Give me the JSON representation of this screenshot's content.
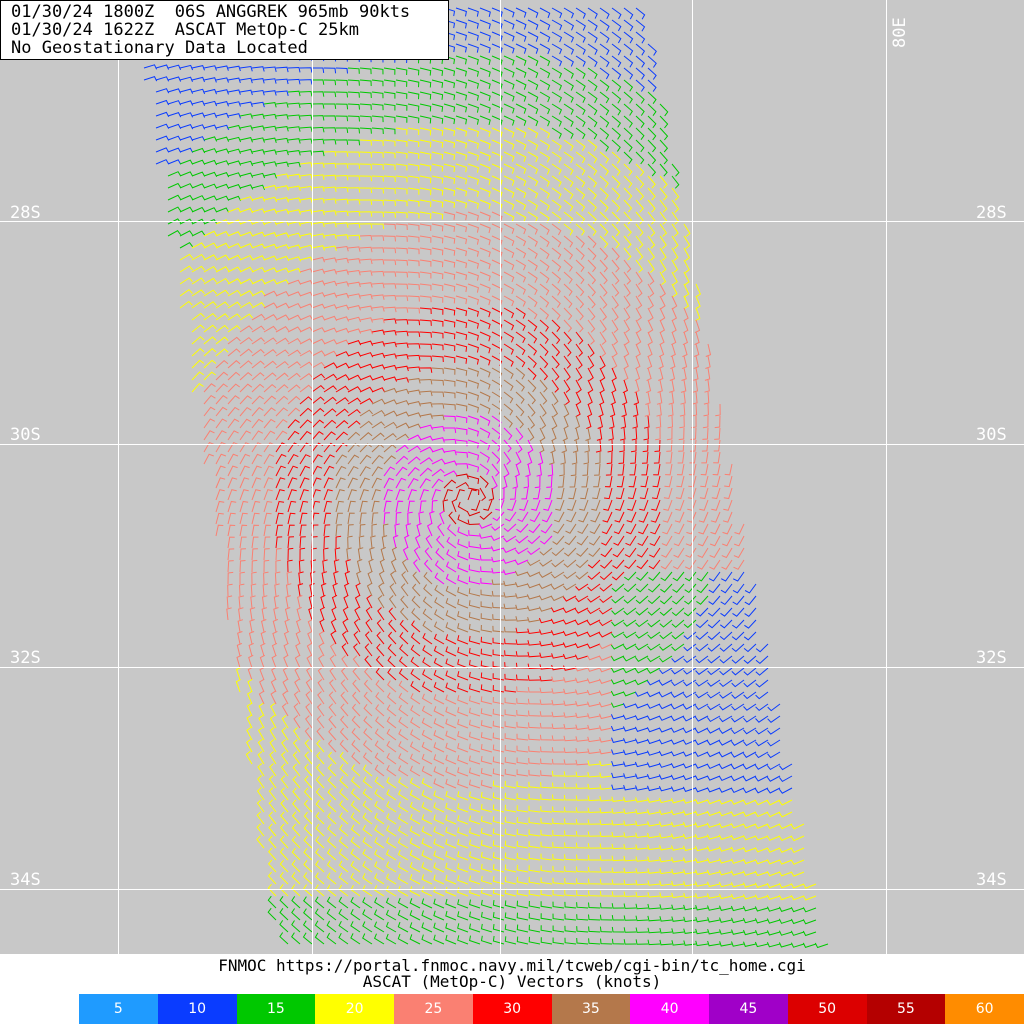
{
  "header": {
    "line1": "01/30/24 1800Z  06S ANGGREK 965mb 90kts",
    "line2": "01/30/24 1622Z  ASCAT MetOp-C 25km",
    "line3": "No Geostationary Data Located"
  },
  "map": {
    "latitudes": [
      "28S",
      "30S",
      "32S",
      "34S"
    ],
    "longitude": "80E",
    "background": "#c8c8c8",
    "gridline_color": "#ffffff"
  },
  "footer": {
    "source": "FNMOC https://portal.fnmoc.navy.mil/tcweb/cgi-bin/tc_home.cgi",
    "product": "ASCAT (MetOp-C) Vectors (knots)"
  },
  "legend": [
    {
      "label": "5",
      "color": "#1f9bff"
    },
    {
      "label": "10",
      "color": "#0a3cff"
    },
    {
      "label": "15",
      "color": "#00c800"
    },
    {
      "label": "20",
      "color": "#ffff00"
    },
    {
      "label": "25",
      "color": "#fa8072"
    },
    {
      "label": "30",
      "color": "#ff0000"
    },
    {
      "label": "35",
      "color": "#b4784b"
    },
    {
      "label": "40",
      "color": "#ff00ff"
    },
    {
      "label": "45",
      "color": "#a000c8"
    },
    {
      "label": "50",
      "color": "#dc0000"
    },
    {
      "label": "55",
      "color": "#b40000"
    },
    {
      "label": "60",
      "color": "#ff8c00"
    }
  ]
}
